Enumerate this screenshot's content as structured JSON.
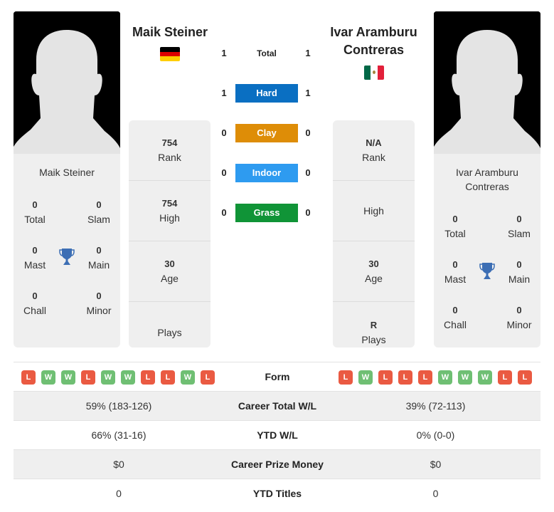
{
  "colors": {
    "hard": "#0a6fc2",
    "clay": "#de8d07",
    "indoor": "#2e9bf0",
    "grass": "#109437",
    "win": "#6fbf73",
    "loss": "#ea5a42",
    "trophy": "#3c6eb4"
  },
  "player_left": {
    "name": "Maik Steiner",
    "flag": "germany-flag",
    "card_name": "Maik Steiner",
    "titles": {
      "total": {
        "value": "0",
        "label": "Total"
      },
      "slam": {
        "value": "0",
        "label": "Slam"
      },
      "mast": {
        "value": "0",
        "label": "Mast"
      },
      "main": {
        "value": "0",
        "label": "Main"
      },
      "chall": {
        "value": "0",
        "label": "Chall"
      },
      "minor": {
        "value": "0",
        "label": "Minor"
      }
    },
    "stats": {
      "rank": {
        "value": "754",
        "label": "Rank"
      },
      "high": {
        "value": "754",
        "label": "High"
      },
      "age": {
        "value": "30",
        "label": "Age"
      },
      "plays": {
        "value": "",
        "label": "Plays"
      }
    },
    "form": [
      "L",
      "W",
      "W",
      "L",
      "W",
      "W",
      "L",
      "L",
      "W",
      "L"
    ]
  },
  "player_right": {
    "name": "Ivar Aramburu Contreras",
    "flag": "mexico-flag",
    "card_name": "Ivar Aramburu Contreras",
    "titles": {
      "total": {
        "value": "0",
        "label": "Total"
      },
      "slam": {
        "value": "0",
        "label": "Slam"
      },
      "mast": {
        "value": "0",
        "label": "Mast"
      },
      "main": {
        "value": "0",
        "label": "Main"
      },
      "chall": {
        "value": "0",
        "label": "Chall"
      },
      "minor": {
        "value": "0",
        "label": "Minor"
      }
    },
    "stats": {
      "rank": {
        "value": "N/A",
        "label": "Rank"
      },
      "high": {
        "value": "",
        "label": "High"
      },
      "age": {
        "value": "30",
        "label": "Age"
      },
      "plays": {
        "value": "R",
        "label": "Plays"
      }
    },
    "form": [
      "L",
      "W",
      "L",
      "L",
      "L",
      "W",
      "W",
      "W",
      "L",
      "L"
    ]
  },
  "h2h": [
    {
      "key": "total",
      "label": "Total",
      "left": "1",
      "right": "1"
    },
    {
      "key": "hard",
      "label": "Hard",
      "left": "1",
      "right": "1"
    },
    {
      "key": "clay",
      "label": "Clay",
      "left": "0",
      "right": "0"
    },
    {
      "key": "indoor",
      "label": "Indoor",
      "left": "0",
      "right": "0"
    },
    {
      "key": "grass",
      "label": "Grass",
      "left": "0",
      "right": "0"
    }
  ],
  "comparison": {
    "form_label": "Form",
    "rows": [
      {
        "label": "Career Total W/L",
        "left": "59% (183-126)",
        "right": "39% (72-113)"
      },
      {
        "label": "YTD W/L",
        "left": "66% (31-16)",
        "right": "0% (0-0)"
      },
      {
        "label": "Career Prize Money",
        "left": "$0",
        "right": "$0"
      },
      {
        "label": "YTD Titles",
        "left": "0",
        "right": "0"
      }
    ]
  }
}
